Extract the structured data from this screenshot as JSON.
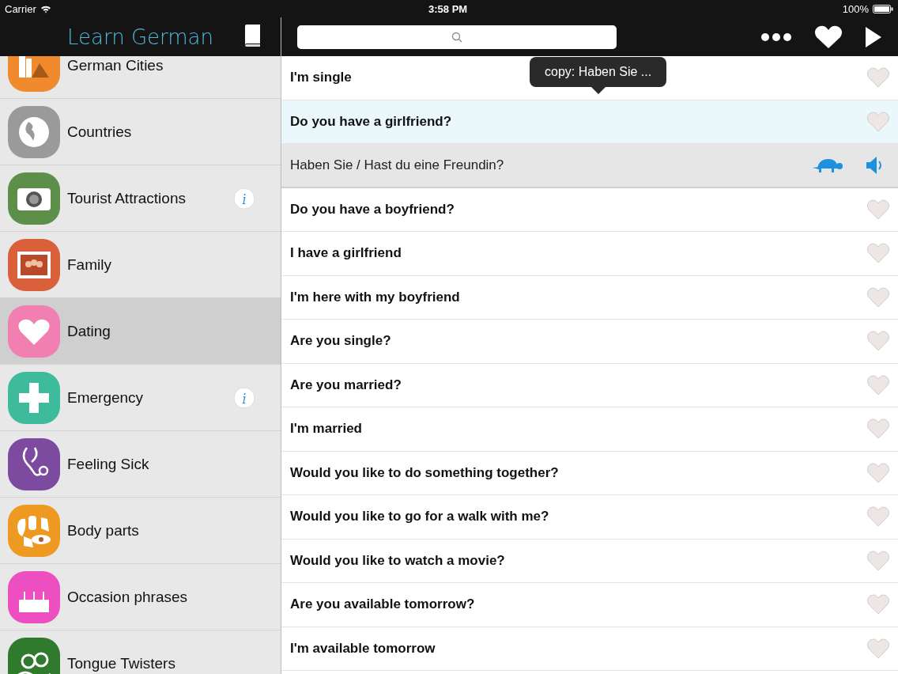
{
  "status_bar": {
    "carrier": "Carrier",
    "time": "3:58 PM",
    "battery": "100%"
  },
  "sidebar": {
    "title": "Learn German",
    "items": [
      {
        "label": "German Cities",
        "color": "#f08a2c",
        "selected": false,
        "info": false
      },
      {
        "label": "Countries",
        "color": "#9a9a9a",
        "selected": false,
        "info": false
      },
      {
        "label": "Tourist Attractions",
        "color": "#5e8f4a",
        "selected": false,
        "info": true
      },
      {
        "label": "Family",
        "color": "#d9603a",
        "selected": false,
        "info": false
      },
      {
        "label": "Dating",
        "color": "#f27fb2",
        "selected": true,
        "info": false
      },
      {
        "label": "Emergency",
        "color": "#3dbb9c",
        "selected": false,
        "info": true
      },
      {
        "label": "Feeling Sick",
        "color": "#7c4a9e",
        "selected": false,
        "info": false
      },
      {
        "label": "Body parts",
        "color": "#ee9a22",
        "selected": false,
        "info": false
      },
      {
        "label": "Occasion phrases",
        "color": "#ee4fc0",
        "selected": false,
        "info": false
      },
      {
        "label": "Tongue Twisters",
        "color": "#2f7a2c",
        "selected": false,
        "info": false
      }
    ]
  },
  "tooltip": "copy: Haben Sie ...",
  "phrases": [
    {
      "kind": "phrase",
      "text": "I'm single",
      "selected": false,
      "favorite": false
    },
    {
      "kind": "phrase",
      "text": "Do you have a girlfriend?",
      "selected": true,
      "favorite": false
    },
    {
      "kind": "translation",
      "text": "Haben Sie / Hast du eine Freundin?"
    },
    {
      "kind": "phrase",
      "text": "Do you have a boyfriend?",
      "selected": false,
      "favorite": false
    },
    {
      "kind": "phrase",
      "text": "I have a girlfriend",
      "selected": false,
      "favorite": false
    },
    {
      "kind": "phrase",
      "text": "I'm here with my boyfriend",
      "selected": false,
      "favorite": false
    },
    {
      "kind": "phrase",
      "text": "Are you single?",
      "selected": false,
      "favorite": false
    },
    {
      "kind": "phrase",
      "text": "Are you married?",
      "selected": false,
      "favorite": false
    },
    {
      "kind": "phrase",
      "text": "I'm married",
      "selected": false,
      "favorite": false
    },
    {
      "kind": "phrase",
      "text": "Would you like to do something together?",
      "selected": false,
      "favorite": false
    },
    {
      "kind": "phrase",
      "text": "Would you like to go for a walk with me?",
      "selected": false,
      "favorite": false
    },
    {
      "kind": "phrase",
      "text": "Would you like to watch a movie?",
      "selected": false,
      "favorite": false
    },
    {
      "kind": "phrase",
      "text": "Are you available tomorrow?",
      "selected": false,
      "favorite": false
    },
    {
      "kind": "phrase",
      "text": "I'm available tomorrow",
      "selected": false,
      "favorite": false
    }
  ]
}
